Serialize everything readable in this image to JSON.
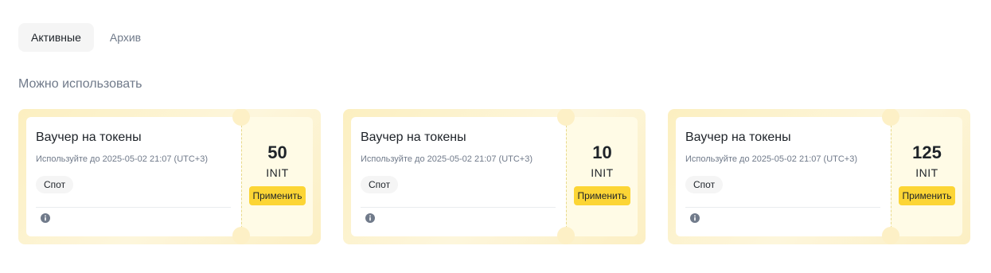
{
  "tabs": [
    {
      "label": "Активные",
      "active": true
    },
    {
      "label": "Архив",
      "active": false
    }
  ],
  "section_title": "Можно использовать",
  "vouchers": [
    {
      "title": "Ваучер на токены",
      "expiry": "Используйте до 2025-05-02 21:07 (UTC+3)",
      "badge": "Спот",
      "amount": "50",
      "unit": "INIT",
      "apply_label": "Применить",
      "icon": "info-icon"
    },
    {
      "title": "Ваучер на токены",
      "expiry": "Используйте до 2025-05-02 21:07 (UTC+3)",
      "badge": "Спот",
      "amount": "10",
      "unit": "INIT",
      "apply_label": "Применить",
      "icon": "info-icon"
    },
    {
      "title": "Ваучер на токены",
      "expiry": "Используйте до 2025-05-02 21:07 (UTC+3)",
      "badge": "Спот",
      "amount": "125",
      "unit": "INIT",
      "apply_label": "Применить",
      "icon": "info-icon"
    }
  ],
  "colors": {
    "accent": "#fcd535",
    "card_bg": "#fcefc0",
    "text_primary": "#1e2329",
    "text_secondary": "#707a8a"
  }
}
